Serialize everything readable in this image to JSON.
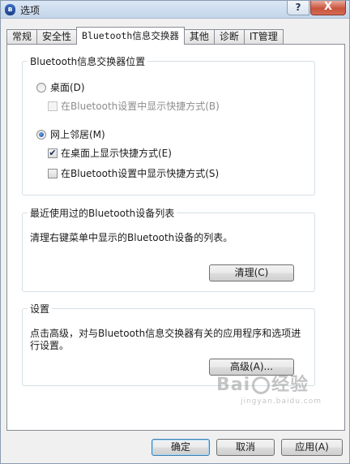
{
  "window": {
    "title": "选项",
    "help_label": "?",
    "close_label": "X"
  },
  "tabs": [
    {
      "label": "常规"
    },
    {
      "label": "安全性"
    },
    {
      "label": "Bluetooth信息交换器"
    },
    {
      "label": "其他"
    },
    {
      "label": "诊断"
    },
    {
      "label": "IT管理"
    }
  ],
  "location_group": {
    "title": "Bluetooth信息交换器位置",
    "desktop_radio": "桌面(D)",
    "desktop_shortcut": "在Bluetooth设置中显示快捷方式(B)",
    "network_radio": "网上邻居(M)",
    "show_on_desktop": "在桌面上显示快捷方式(E)",
    "show_in_settings": "在Bluetooth设置中显示快捷方式(S)",
    "check_mark": "✔"
  },
  "recent_group": {
    "title": "最近使用过的Bluetooth设备列表",
    "description": "清理右键菜单中显示的Bluetooth设备的列表。",
    "clear_button": "清理(C)"
  },
  "settings_group": {
    "title": "设置",
    "description": "点击高级，对与Bluetooth信息交换器有关的应用程序和选项进行设置。",
    "advanced_button": "高级(A)..."
  },
  "footer": {
    "ok": "确定",
    "cancel": "取消",
    "apply": "应用(A)"
  },
  "watermark": {
    "text": "Bai",
    "suffix": "经验",
    "sub": "jingyan.baidu.com"
  }
}
